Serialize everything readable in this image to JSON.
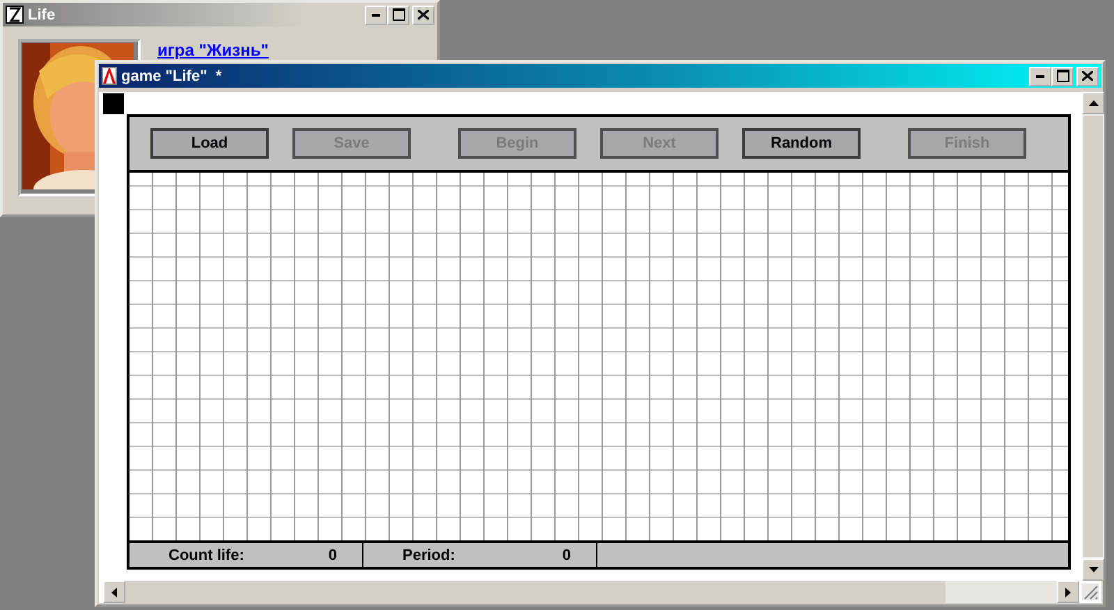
{
  "back_window": {
    "title": "Life",
    "link": "игра \"Жизнь\""
  },
  "window": {
    "title": "game \"Life\"  *",
    "buttons": [
      {
        "label": "Load",
        "disabled": false
      },
      {
        "label": "Save",
        "disabled": true
      },
      {
        "label": "Begin",
        "disabled": true
      },
      {
        "label": "Next",
        "disabled": true
      },
      {
        "label": "Random",
        "disabled": false
      },
      {
        "label": "Finish",
        "disabled": true
      }
    ],
    "status": [
      {
        "label": "Count life:",
        "value": "0"
      },
      {
        "label": "Period:",
        "value": "0"
      }
    ]
  }
}
